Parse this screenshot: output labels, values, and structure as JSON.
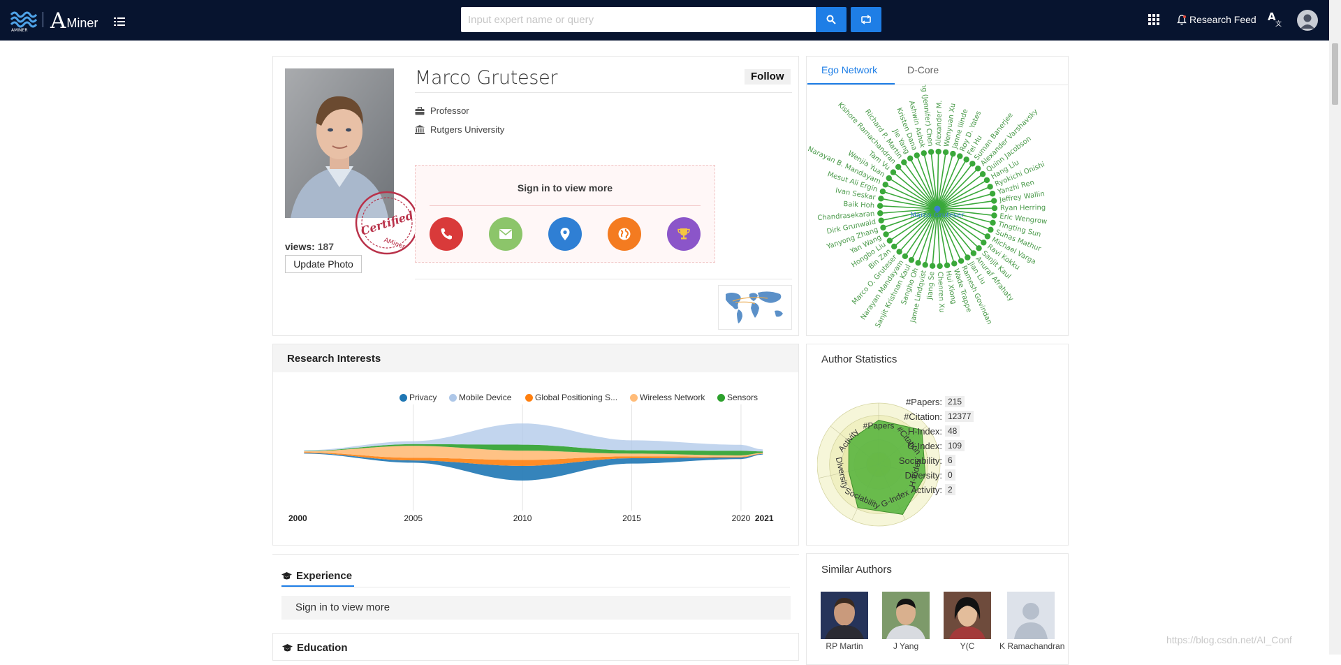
{
  "header": {
    "logo_text_a": "A",
    "logo_text_miner": "Miner",
    "search_placeholder": "Input expert name or query",
    "research_feed": "Research Feed",
    "icons": [
      "waves-logo-icon",
      "menu-icon",
      "search-icon",
      "switch-icon",
      "apps-grid-icon",
      "bell-icon",
      "translate-icon",
      "user-avatar-icon"
    ]
  },
  "profile": {
    "name": "Marco Gruteser",
    "follow_label": "Follow",
    "position": "Professor",
    "affiliation": "Rutgers University",
    "views_label": "views:",
    "views_count": "187",
    "update_photo_label": "Update Photo",
    "stamp_text": "Certified",
    "stamp_sub": "AMiner",
    "signin_title": "Sign in to view more",
    "contact_buttons": [
      {
        "name": "phone",
        "color": "#d93a3a"
      },
      {
        "name": "email",
        "color": "#8cc56a"
      },
      {
        "name": "location",
        "color": "#2f7fd4"
      },
      {
        "name": "homepage",
        "color": "#f47b20"
      },
      {
        "name": "awards",
        "color": "#8b55c9"
      }
    ]
  },
  "ego_network": {
    "tabs": [
      "Ego Network",
      "D-Core"
    ],
    "active_tab": "Ego Network",
    "center": "Marco Gruteser",
    "node_color": "#3aa83a",
    "nodes": [
      "Alexander M.",
      "Wenyuan Xu",
      "Janne Ilinde",
      "Roy D. Yates",
      "Fei Hu",
      "Suman Banerjee",
      "Alexander Varshavsky",
      "Quinn Jacobson",
      "Hang Liu",
      "Ryokichi Onishi",
      "Yanzhi Ren",
      "Jeffrey Wallin",
      "Ryan Herring",
      "Eric Wengrow",
      "Tingting Sun",
      "Suhas Mathur",
      "Michael Varga",
      "Ravi Kokku",
      "Sanjit Kaul",
      "Anuraf Afrahaty",
      "Jian Liu",
      "Ramesh Govindan",
      "Wade Trappe",
      "Hui Xiong",
      "Chenren Xu",
      "Jiang Se",
      "Janne Lindqvist",
      "Sangho Oh",
      "Sanjit Krishnan Kaul",
      "Narayan Mandayam",
      "Marco O. Gruteser",
      "Bin Zan",
      "Hongbo Liu",
      "Yan Wang",
      "Yanyong Zhang",
      "Dirk Grunwald",
      "Chandrasekaran",
      "Baik Hoh",
      "Ivan Seskar",
      "Mesut Ali Ergin",
      "Narayan B. Mandayam",
      "Wenjia Yuan",
      "Tam Vu",
      "Kishore Ramachandran",
      "Richard P. Martin",
      "Jie Yang",
      "Kristen Dana",
      "Ashwin Ashok",
      "Yingying (Jennifer) Chen"
    ]
  },
  "research_interests": {
    "title": "Research Interests",
    "chart_data": {
      "type": "area",
      "x": [
        2000,
        2005,
        2010,
        2015,
        2020,
        2021
      ],
      "series": [
        {
          "name": "Privacy",
          "color": "#1f77b4",
          "values": [
            0.1,
            0.35,
            2.2,
            0.8,
            0.25,
            0.1
          ]
        },
        {
          "name": "Mobile Device",
          "color": "#aec7e8",
          "values": [
            0.1,
            0.45,
            3.2,
            1.5,
            0.9,
            0.3
          ]
        },
        {
          "name": "Global Positioning S...",
          "color": "#ff7f0e",
          "values": [
            0.1,
            0.4,
            0.9,
            0.3,
            0.1,
            0.05
          ]
        },
        {
          "name": "Wireless Network",
          "color": "#ffbb78",
          "values": [
            0.15,
            1.8,
            1.4,
            0.4,
            0.2,
            0.1
          ]
        },
        {
          "name": "Sensors",
          "color": "#2ca02c",
          "values": [
            0.05,
            0.25,
            0.9,
            0.5,
            0.7,
            0.2
          ]
        }
      ],
      "tick_labels": [
        "2000",
        "2005",
        "2010",
        "2015",
        "2020",
        "2021"
      ],
      "legend_position": "top"
    }
  },
  "author_statistics": {
    "title": "Author Statistics",
    "radar_axes": [
      "#Papers",
      "#Citation",
      "H-Index",
      "G-Index",
      "Sociability",
      "Diversity",
      "Activity"
    ],
    "radar_values": [
      0.72,
      0.9,
      0.78,
      0.9,
      0.78,
      0.5,
      0.62
    ],
    "rows": [
      {
        "label": "#Papers:",
        "value": "215"
      },
      {
        "label": "#Citation:",
        "value": "12377"
      },
      {
        "label": "H-Index:",
        "value": "48"
      },
      {
        "label": "G-Index:",
        "value": "109"
      },
      {
        "label": "Sociability:",
        "value": "6"
      },
      {
        "label": "Diversity:",
        "value": "0"
      },
      {
        "label": "Activity:",
        "value": "2"
      }
    ]
  },
  "experience": {
    "title": "Experience",
    "signin_text": "Sign in to view more"
  },
  "education": {
    "title": "Education"
  },
  "similar_authors": {
    "title": "Similar Authors",
    "authors": [
      {
        "name": "RP Martin"
      },
      {
        "name": "J Yang"
      },
      {
        "name": "Y(C"
      },
      {
        "name": "K Ramachandran"
      }
    ]
  },
  "watermark": "https://blog.csdn.net/AI_Conf"
}
